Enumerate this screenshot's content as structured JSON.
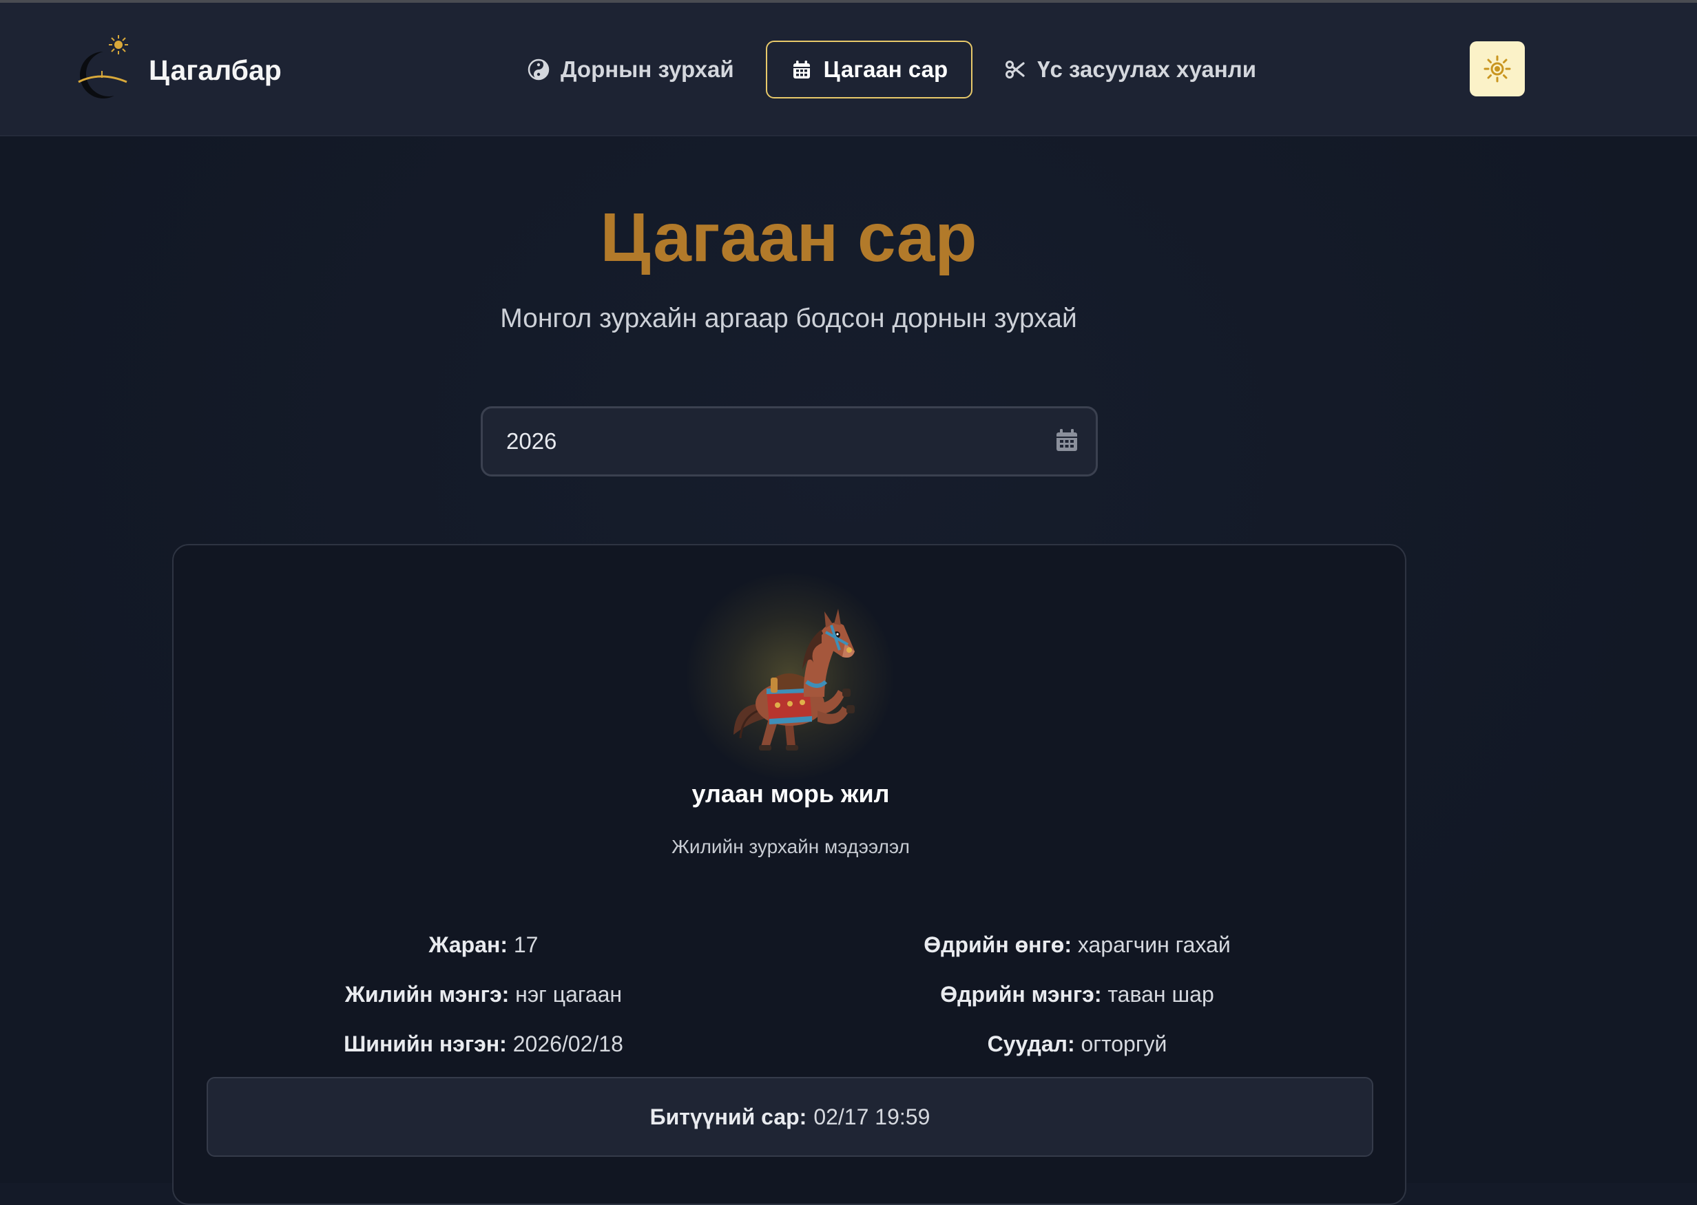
{
  "app": {
    "brand_name": "Цагалбар"
  },
  "nav": {
    "items": [
      {
        "label": "Дорнын зурхай",
        "icon": "yin-yang-icon",
        "active": false
      },
      {
        "label": "Цагаан сар",
        "icon": "calendar-icon",
        "active": true
      },
      {
        "label": "Үс засуулах хуанли",
        "icon": "scissors-icon",
        "active": false
      }
    ],
    "theme_toggle_icon": "sun-icon"
  },
  "page": {
    "title": "Цагаан сар",
    "subtitle": "Монгол зурхайн аргаар бодсон дорнын зурхай"
  },
  "year_picker": {
    "value": "2026",
    "icon": "calendar-icon"
  },
  "card": {
    "animal_icon": "horse-icon",
    "year_name": "улаан морь жил",
    "year_sub": "Жилийн зурхайн мэдээлэл",
    "left": [
      {
        "label": "Жаран:",
        "value": "17"
      },
      {
        "label": "Жилийн мэнгэ:",
        "value": "нэг цагаан"
      },
      {
        "label": "Шинийн нэгэн:",
        "value": "2026/02/18"
      }
    ],
    "right": [
      {
        "label": "Өдрийн өнгө:",
        "value": "харагчин гахай"
      },
      {
        "label": "Өдрийн мэнгэ:",
        "value": "таван шар"
      },
      {
        "label": "Суудал:",
        "value": "огторгуй"
      }
    ],
    "bituun": {
      "label": "Битүүний сар:",
      "value": "02/17 19:59"
    }
  },
  "colors": {
    "accent_gold": "#e8c96a",
    "title_brown": "#b27a2a",
    "header_bg": "#1d2333",
    "page_bg": "#141a28"
  }
}
